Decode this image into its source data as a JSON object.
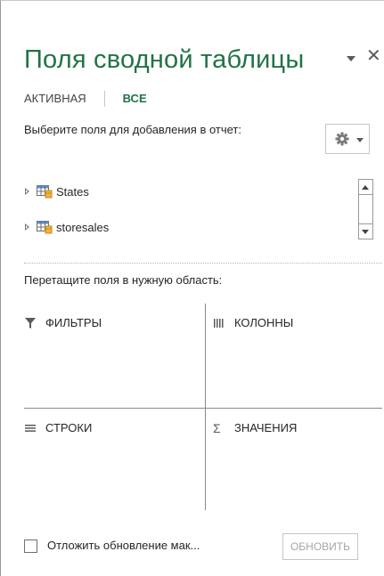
{
  "pane": {
    "title": "Поля сводной таблицы",
    "tabs": [
      {
        "label": "АКТИВНАЯ",
        "active": false
      },
      {
        "label": "ВСЕ",
        "active": true
      }
    ],
    "choose_label": "Выберите поля для добавления в отчет:",
    "fields": [
      {
        "name": "States",
        "expanded": false
      },
      {
        "name": "storesales",
        "expanded": false
      }
    ],
    "drag_label": "Перетащите поля в нужную область:",
    "areas": {
      "filters": "ФИЛЬТРЫ",
      "columns": "КОЛОННЫ",
      "rows": "СТРОКИ",
      "values": "ЗНАЧЕНИЯ"
    },
    "defer_label": "Отложить обновление мак...",
    "defer_checked": false,
    "update_button": "ОБНОВИТЬ",
    "update_enabled": false
  },
  "icons": {
    "title_dropdown": "chevron-down-icon",
    "close": "close-icon",
    "settings": "gear-icon",
    "field_expand": "expand-triangle-icon",
    "table": "table-icon",
    "filters": "filter-funnel-icon",
    "columns": "columns-icon",
    "rows": "rows-icon",
    "values": "sigma-icon"
  },
  "colors": {
    "accent": "#217346",
    "text": "#262626",
    "disabled": "#a6a6a6",
    "border": "#c6c6c6"
  }
}
